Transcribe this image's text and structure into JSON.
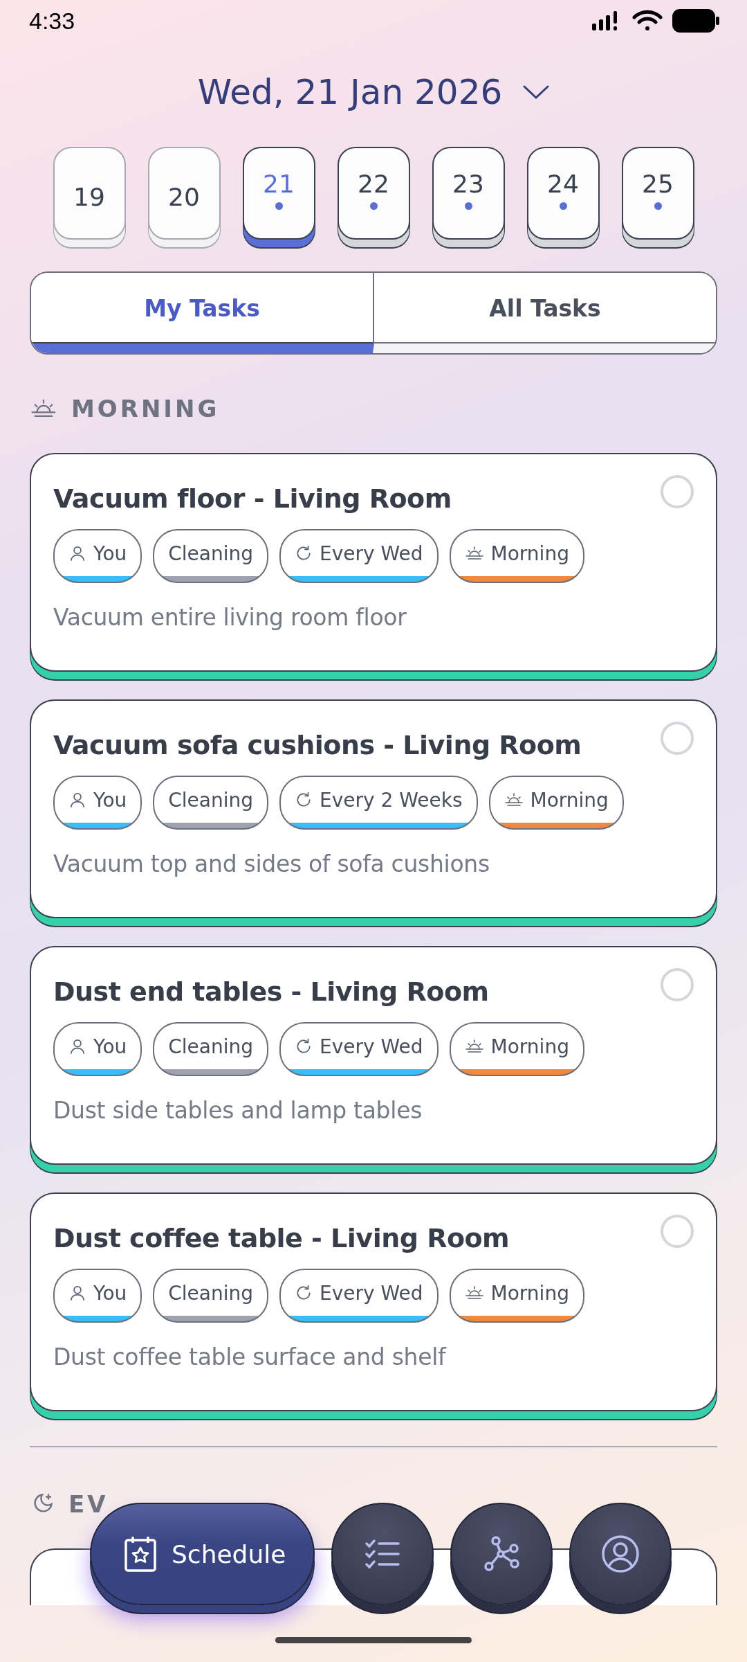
{
  "status_bar": {
    "time": "4:33"
  },
  "date_title": "Wed, 21 Jan 2026",
  "days": [
    {
      "label": "19",
      "past": true,
      "has_tasks": false,
      "selected": false
    },
    {
      "label": "20",
      "past": true,
      "has_tasks": false,
      "selected": false
    },
    {
      "label": "21",
      "past": false,
      "has_tasks": true,
      "selected": true
    },
    {
      "label": "22",
      "past": false,
      "has_tasks": true,
      "selected": false
    },
    {
      "label": "23",
      "past": false,
      "has_tasks": true,
      "selected": false
    },
    {
      "label": "24",
      "past": false,
      "has_tasks": true,
      "selected": false
    },
    {
      "label": "25",
      "past": false,
      "has_tasks": true,
      "selected": false
    }
  ],
  "tabs": [
    {
      "label": "My Tasks",
      "selected": true
    },
    {
      "label": "All Tasks",
      "selected": false
    }
  ],
  "sections": [
    {
      "kind": "morning",
      "title": "MORNING",
      "tasks": [
        {
          "title": "Vacuum floor - Living Room",
          "done": false,
          "description": "Vacuum entire living room floor",
          "tags": [
            {
              "kind": "person",
              "label": "You",
              "color": "#38bdf8"
            },
            {
              "kind": "category",
              "label": "Cleaning",
              "color": "#9ca3af"
            },
            {
              "kind": "repeat",
              "label": "Every Wed",
              "color": "#38bdf8"
            },
            {
              "kind": "time",
              "label": "Morning",
              "color": "#f0883e"
            }
          ]
        },
        {
          "title": "Vacuum sofa cushions - Living Room",
          "done": false,
          "description": "Vacuum top and sides of sofa cushions",
          "tags": [
            {
              "kind": "person",
              "label": "You",
              "color": "#38bdf8"
            },
            {
              "kind": "category",
              "label": "Cleaning",
              "color": "#9ca3af"
            },
            {
              "kind": "repeat",
              "label": "Every 2 Weeks",
              "color": "#38bdf8"
            },
            {
              "kind": "time",
              "label": "Morning",
              "color": "#f0883e"
            }
          ]
        },
        {
          "title": "Dust end tables - Living Room",
          "done": false,
          "description": "Dust side tables and lamp tables",
          "tags": [
            {
              "kind": "person",
              "label": "You",
              "color": "#38bdf8"
            },
            {
              "kind": "category",
              "label": "Cleaning",
              "color": "#9ca3af"
            },
            {
              "kind": "repeat",
              "label": "Every Wed",
              "color": "#38bdf8"
            },
            {
              "kind": "time",
              "label": "Morning",
              "color": "#f0883e"
            }
          ]
        },
        {
          "title": "Dust coffee table - Living Room",
          "done": false,
          "description": "Dust coffee table surface and shelf",
          "tags": [
            {
              "kind": "person",
              "label": "You",
              "color": "#38bdf8"
            },
            {
              "kind": "category",
              "label": "Cleaning",
              "color": "#9ca3af"
            },
            {
              "kind": "repeat",
              "label": "Every Wed",
              "color": "#38bdf8"
            },
            {
              "kind": "time",
              "label": "Morning",
              "color": "#f0883e"
            }
          ]
        }
      ]
    },
    {
      "kind": "evening",
      "title": "EV"
    }
  ],
  "nav": [
    {
      "kind": "schedule",
      "label": "Schedule",
      "selected": true
    },
    {
      "kind": "tasks",
      "selected": false
    },
    {
      "kind": "graph",
      "selected": false
    },
    {
      "kind": "profile",
      "selected": false
    }
  ]
}
